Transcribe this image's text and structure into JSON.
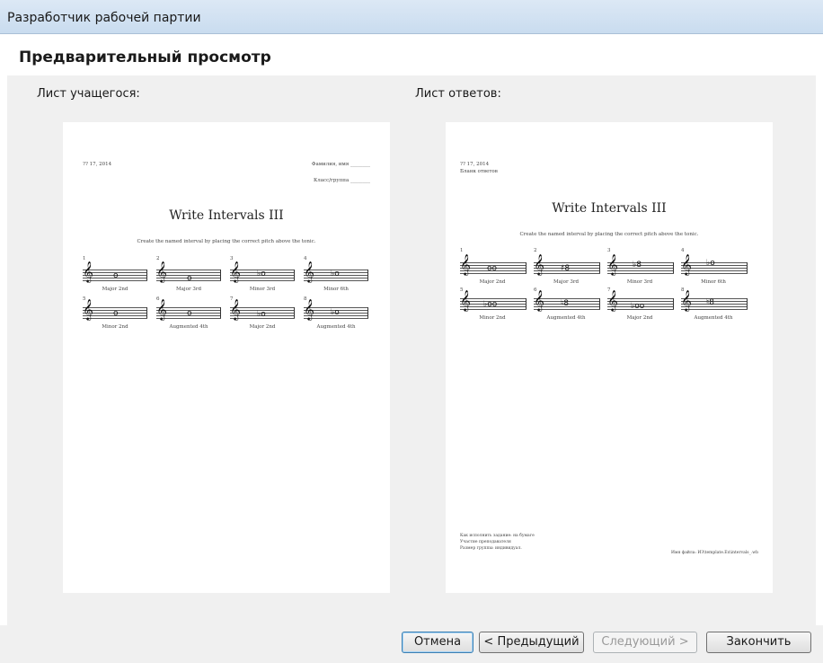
{
  "window": {
    "title": "Разработчик рабочей партии"
  },
  "header": {
    "title": "Предварительный просмотр"
  },
  "student": {
    "label": "Лист учащегося:",
    "date": "?? 17, 2014",
    "name_field": "Фамилия, имя ________",
    "class_field": "Класс/группа ________",
    "title": "Write Intervals III",
    "instruction": "Create the named interval by placing the correct pitch above the tonic.",
    "items": [
      {
        "n": "1",
        "label": "Major 2nd"
      },
      {
        "n": "2",
        "label": "Major 3rd"
      },
      {
        "n": "3",
        "label": "Minor 3rd"
      },
      {
        "n": "4",
        "label": "Minor 6th"
      },
      {
        "n": "5",
        "label": "Minor 2nd"
      },
      {
        "n": "6",
        "label": "Augmented 4th"
      },
      {
        "n": "7",
        "label": "Major 2nd"
      },
      {
        "n": "8",
        "label": "Augmented 4th"
      }
    ]
  },
  "answer": {
    "label": "Лист ответов:",
    "date": "?? 17, 2014",
    "subtitle": "Бланк ответов",
    "title": "Write Intervals III",
    "instruction": "Create the named interval by placing the correct pitch above the tonic.",
    "items": [
      {
        "n": "1",
        "label": "Major 2nd"
      },
      {
        "n": "2",
        "label": "Major 3rd"
      },
      {
        "n": "3",
        "label": "Minor 3rd"
      },
      {
        "n": "4",
        "label": "Minor 6th"
      },
      {
        "n": "5",
        "label": "Minor 2nd"
      },
      {
        "n": "6",
        "label": "Augmented 4th"
      },
      {
        "n": "7",
        "label": "Major 2nd"
      },
      {
        "n": "8",
        "label": "Augmented 4th"
      }
    ],
    "footer_left_1": "Как исполнить задание: на бумаге",
    "footer_left_2": "Участие преподавателя",
    "footer_left_3": "Размер группы: индивидуал.",
    "footer_right": "Имя файла: ИЗ\\template.Ex\\intervals_.wb"
  },
  "buttons": {
    "cancel": "Отмена",
    "prev": "< Предыдущий",
    "next": "Следующий >",
    "finish": "Закончить"
  }
}
